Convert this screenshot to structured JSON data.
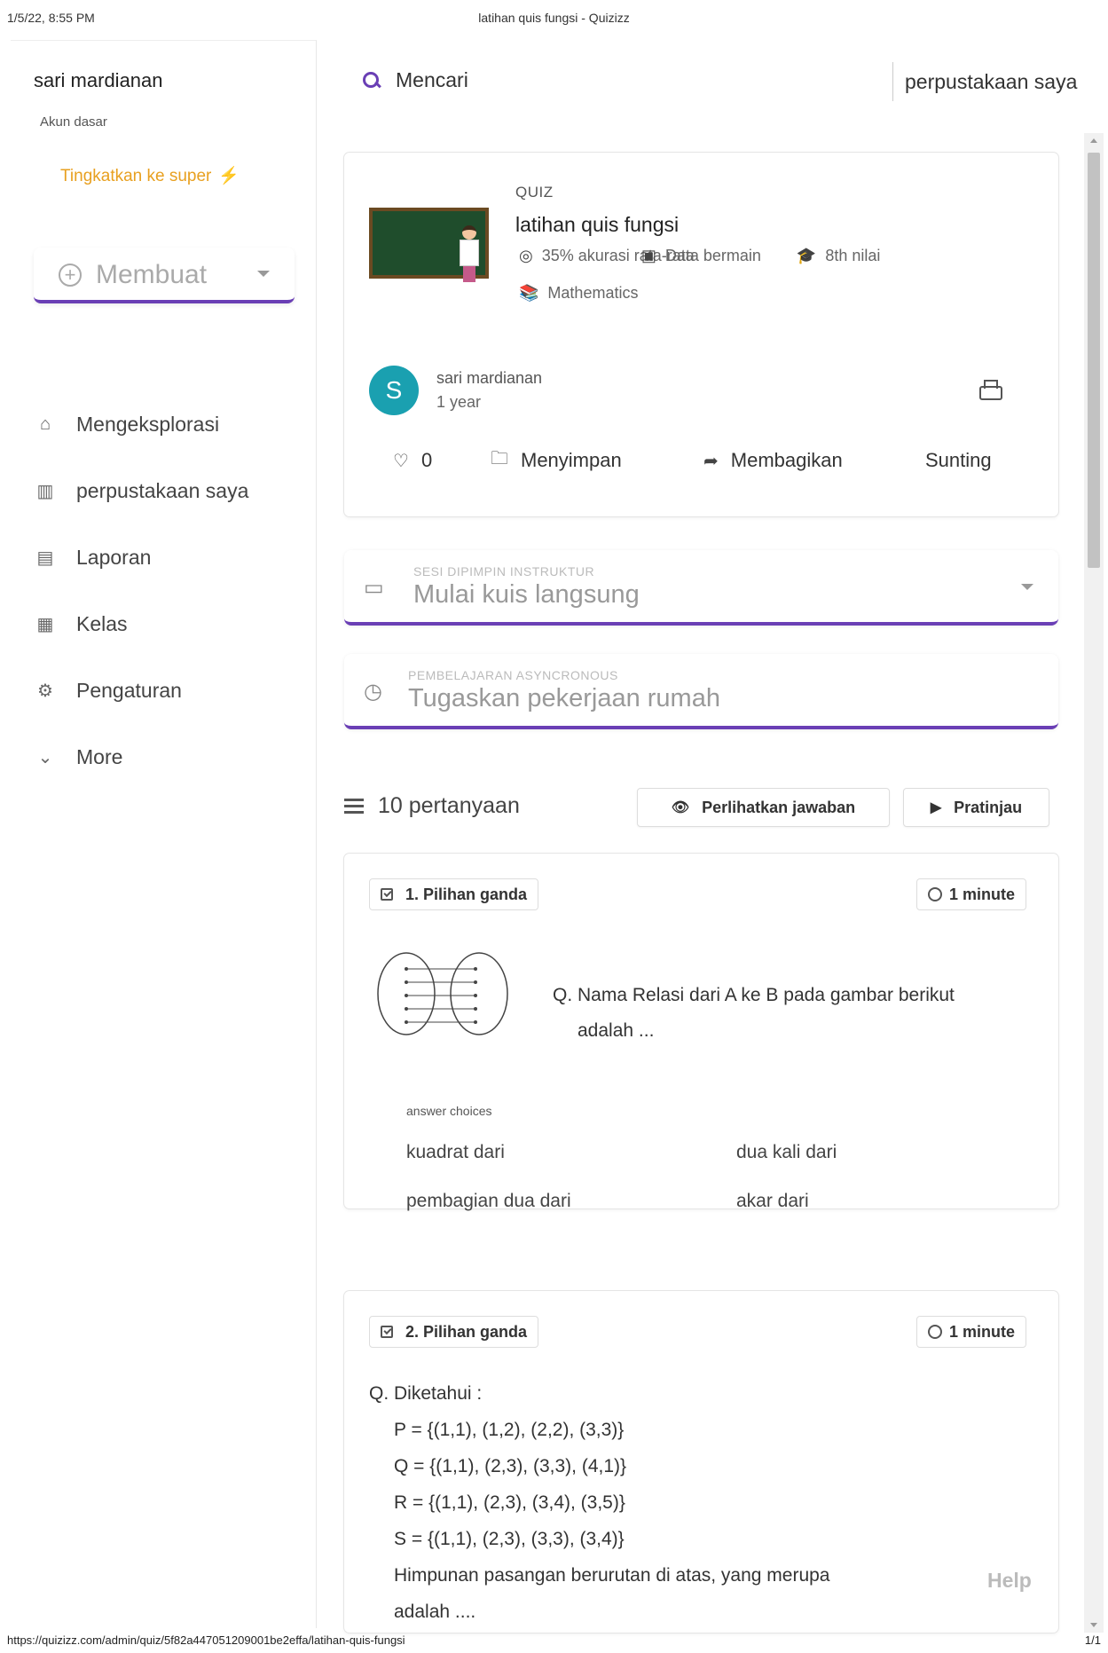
{
  "print": {
    "datetime": "1/5/22, 8:55 PM",
    "title": "latihan quis fungsi - Quizizz",
    "url": "https://quizizz.com/admin/quiz/5f82a447051209001be2effa/latihan-quis-fungsi",
    "page": "1/1"
  },
  "sidebar": {
    "user_name": "sari mardianan",
    "account_type": "Akun dasar",
    "upgrade_label": "Tingkatkan ke super",
    "create_label": "Membuat",
    "nav": [
      {
        "label": "Mengeksplorasi",
        "icon": "home-icon"
      },
      {
        "label": "perpustakaan saya",
        "icon": "library-icon"
      },
      {
        "label": "Laporan",
        "icon": "reports-icon"
      },
      {
        "label": "Kelas",
        "icon": "classes-icon"
      },
      {
        "label": "Pengaturan",
        "icon": "settings-icon"
      },
      {
        "label": "More",
        "icon": "chevron-down-icon"
      }
    ]
  },
  "topbar": {
    "search_label": "Mencari",
    "library_label": "perpustakaan saya"
  },
  "quiz": {
    "type_label": "QUIZ",
    "title": "latihan quis fungsi",
    "accuracy": "35% akurasi rata-rata",
    "plays": "Data bermain",
    "grade": "8th nilai",
    "subject": "Mathematics",
    "author_initial": "S",
    "author_name": "sari mardianan",
    "author_time": "1 year",
    "likes": "0",
    "save_label": "Menyimpan",
    "share_label": "Membagikan",
    "edit_label": "Sunting"
  },
  "sessions": {
    "live_small": "SESI DIPIMPIN INSTRUKTUR",
    "live_big": "Mulai kuis langsung",
    "hw_small": "PEMBELAJARAN ASYNCRONOUS",
    "hw_big": "Tugaskan pekerjaan rumah"
  },
  "questions_header": {
    "count": "10 pertanyaan",
    "show_answers": "Perlihatkan jawaban",
    "preview": "Pratinjau"
  },
  "q1": {
    "type": "1. Pilihan ganda",
    "time": "1 minute",
    "text_line1": "Q. Nama Relasi dari A ke B pada gambar berikut",
    "text_line2": "adalah ...",
    "choices_label": "answer choices",
    "choices": [
      "kuadrat dari",
      "dua kali dari",
      "pembagian dua dari",
      "akar dari"
    ]
  },
  "q2": {
    "type": "2. Pilihan ganda",
    "time": "1 minute",
    "intro": "Q. Diketahui :",
    "lines": [
      "P = {(1,1), (1,2), (2,2), (3,3)}",
      "Q = {(1,1), (2,3), (3,3), (4,1)}",
      "R = {(1,1), (2,3), (3,4), (3,5)}",
      "S = {(1,1), (2,3), (3,3), (3,4)}",
      "Himpunan pasangan berurutan di atas, yang merupa",
      "adalah ...."
    ]
  },
  "help_label": "Help",
  "colors": {
    "accent": "#6a3fb5",
    "upgrade": "#e8a020",
    "avatar": "#1aa0b0"
  }
}
